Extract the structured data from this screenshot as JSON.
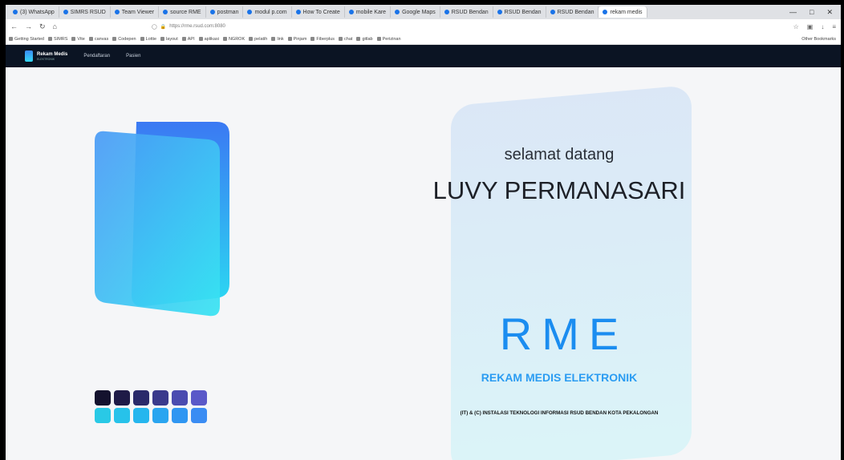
{
  "browser": {
    "tabs": [
      {
        "label": "(3) WhatsApp"
      },
      {
        "label": "SIMRS RSUD"
      },
      {
        "label": "Team Viewer"
      },
      {
        "label": "source RME"
      },
      {
        "label": "postman"
      },
      {
        "label": "modul p.com"
      },
      {
        "label": "How To Create"
      },
      {
        "label": "mobile Kare"
      },
      {
        "label": "Google Maps"
      },
      {
        "label": "RSUD Bendan"
      },
      {
        "label": "RSUD Bendan"
      },
      {
        "label": "RSUD Bendan"
      },
      {
        "label": "rekam medis",
        "active": true
      }
    ],
    "url": "https://rme.rsud.com:8080",
    "bookmarks": [
      "Getting Started",
      "SIMRS",
      "Vite",
      "canvas",
      "Codepen",
      "Lottie",
      "layout",
      "API",
      "aplikasi",
      "NGROK",
      "pelatih",
      "link",
      "Pinjam",
      "Fiberplus",
      "chat",
      "gitlab",
      "Perizinan"
    ],
    "other_bookmarks": "Other Bookmarks"
  },
  "app": {
    "brand": "Rekam Medis",
    "brand_sub": "ELEKTRONIK",
    "nav": [
      "Pendaftaran",
      "Pasien"
    ]
  },
  "welcome": {
    "greeting": "selamat datang",
    "username": "LUVY PERMANASARI",
    "acronym": "RME",
    "subtitle": "REKAM MEDIS ELEKTRONIK",
    "footer": "(IT) & (C) INSTALASI TEKNOLOGI INFORMASI RSUD BENDAN KOTA PEKALONGAN"
  },
  "colors": {
    "dark_dots": [
      "#14122e",
      "#1f1b47",
      "#2a2a6a",
      "#3a3a8c",
      "#4a4bb0",
      "#5a58c8"
    ],
    "light_dots": [
      "#29c9e6",
      "#27c2ea",
      "#25b6ee",
      "#2aa5f0",
      "#2f96f2",
      "#3a8cf3"
    ],
    "accent": "#1b8df0"
  }
}
